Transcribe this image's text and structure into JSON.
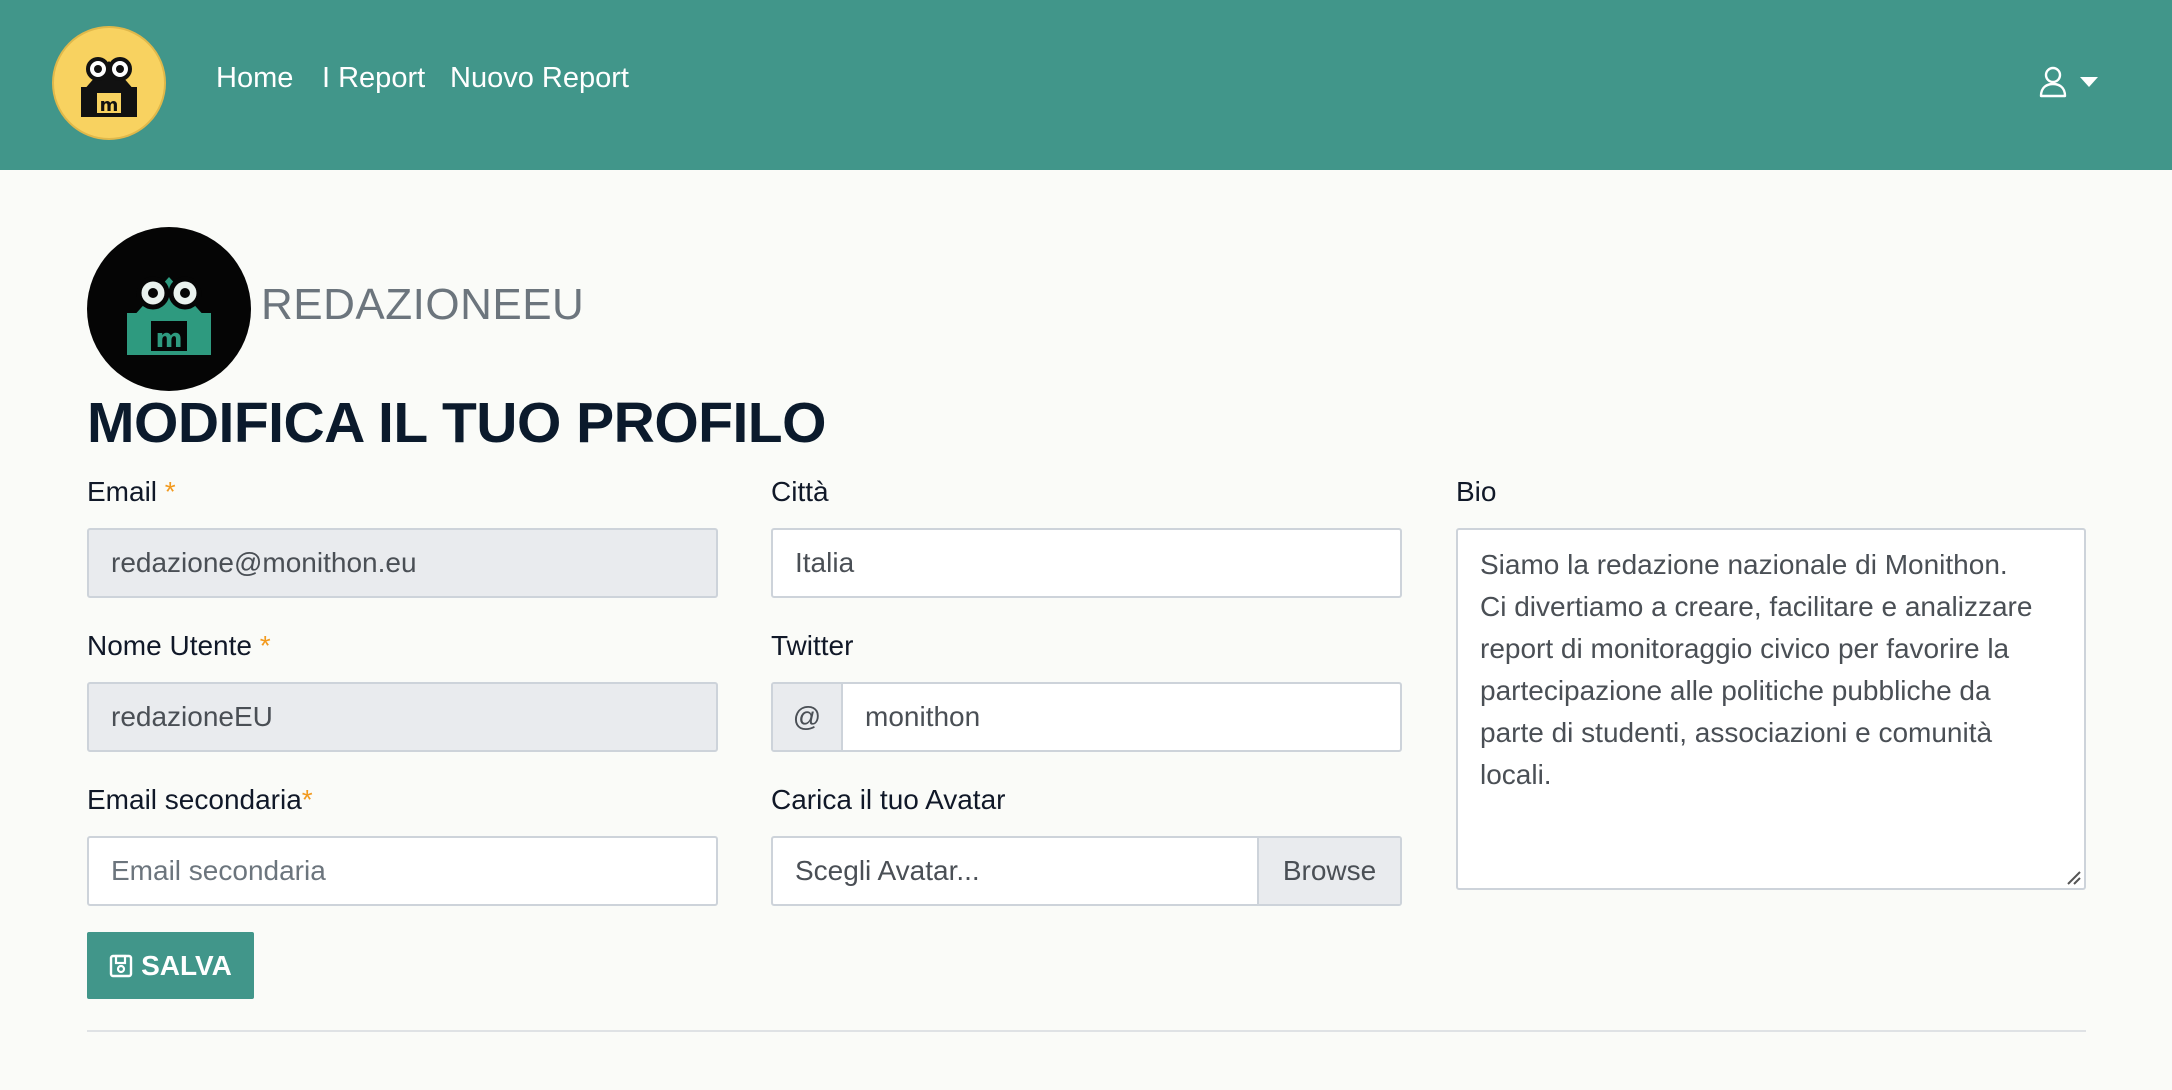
{
  "nav": {
    "items": [
      "Home",
      "I Report",
      "Nuovo Report"
    ],
    "logo_icon": "monithon-logo-icon",
    "user_icon": "user-icon",
    "caret_icon": "caret-down-icon"
  },
  "profile": {
    "username": "REDAZIONEEU",
    "title": "MODIFICA IL TUO PROFILO"
  },
  "form": {
    "email": {
      "label": "Email",
      "required_mark": "*",
      "value": "redazione@monithon.eu"
    },
    "username": {
      "label": "Nome Utente",
      "required_mark": "*",
      "value": "redazioneEU"
    },
    "secondary_email": {
      "label": "Email secondaria",
      "required_mark": "*",
      "placeholder": "Email secondaria"
    },
    "city": {
      "label": "Città",
      "value": "Italia"
    },
    "twitter": {
      "label": "Twitter",
      "prefix": "@",
      "value": "monithon"
    },
    "avatar": {
      "label": "Carica il tuo Avatar",
      "placeholder": "Scegli Avatar...",
      "browse": "Browse"
    },
    "bio": {
      "label": "Bio",
      "lines": [
        "Siamo la redazione nazionale di Monithon.",
        "Ci divertiamo a creare, facilitare e analizzare",
        "report di monitoraggio civico per favorire la",
        "partecipazione alle politiche pubbliche da",
        "parte di studenti, associazioni e comunità",
        "locali."
      ]
    },
    "save_label": "SALVA",
    "save_icon": "save-icon"
  },
  "colors": {
    "brand": "#41968a",
    "required": "#f29a1f",
    "title": "#0b1a2c",
    "logo_yellow": "#f8d260"
  }
}
